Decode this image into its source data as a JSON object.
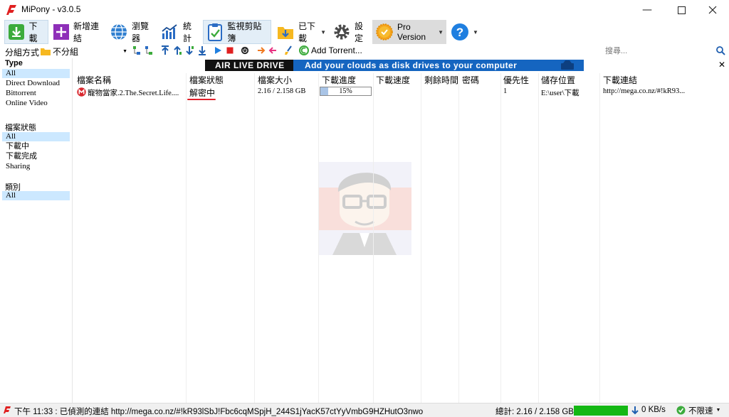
{
  "window": {
    "title": "MiPony - v3.0.5"
  },
  "toolbar": {
    "download": "下載",
    "add_link": "新增連結",
    "browser": "瀏覽器",
    "stats": "統計",
    "clipboard": "監視剪貼簿",
    "downloaded": "已下載",
    "settings": "設定",
    "pro": "Pro Version"
  },
  "filterbar": {
    "group_label": "分組方式",
    "group_value": "不分組",
    "add_torrent": "Add Torrent...",
    "search_placeholder": "搜尋..."
  },
  "sidebar": {
    "type_header": "Type",
    "type_items": [
      "All",
      "Direct Download",
      "Bittorrent",
      "Online Video"
    ],
    "state_header": "檔案狀態",
    "state_items": [
      "All",
      "下載中",
      "下載完成",
      "Sharing"
    ],
    "category_header": "類別",
    "category_items": [
      "All"
    ]
  },
  "banner": {
    "left": "AIR LIVE DRIVE",
    "right": "Add your clouds as disk drives to your computer"
  },
  "table": {
    "headers": [
      "檔案名稱",
      "檔案狀態",
      "檔案大小",
      "下載進度",
      "下載速度",
      "剩餘時間",
      "密碼",
      "優先性",
      "儲存位置",
      "下載連結"
    ],
    "row": {
      "name": "寵物當家.2.The.Secret.Life....",
      "state": "解密中",
      "size": "2.16 / 2.158 GB",
      "progress_text": "15%",
      "progress": 0.15,
      "speed": "",
      "remaining": "",
      "password": "",
      "priority": "1",
      "location": "E:\\user\\下載",
      "link": "http://mega.co.nz/#!kR93..."
    }
  },
  "statusbar": {
    "message": "下午 11:33 : 已偵測的連結 http://mega.co.nz/#!kR93lSbJ!Fbc6cqMSpjH_244S1jYacK57ctYyVmbG9HZHutO3nwo",
    "total": "總計: 2.16 / 2.158 GB",
    "speed": "0 KB/s",
    "limit": "不限速"
  },
  "colors": {
    "accent": "#1565c0",
    "annotation": "#e0202a",
    "speedbar": "#14b814"
  }
}
